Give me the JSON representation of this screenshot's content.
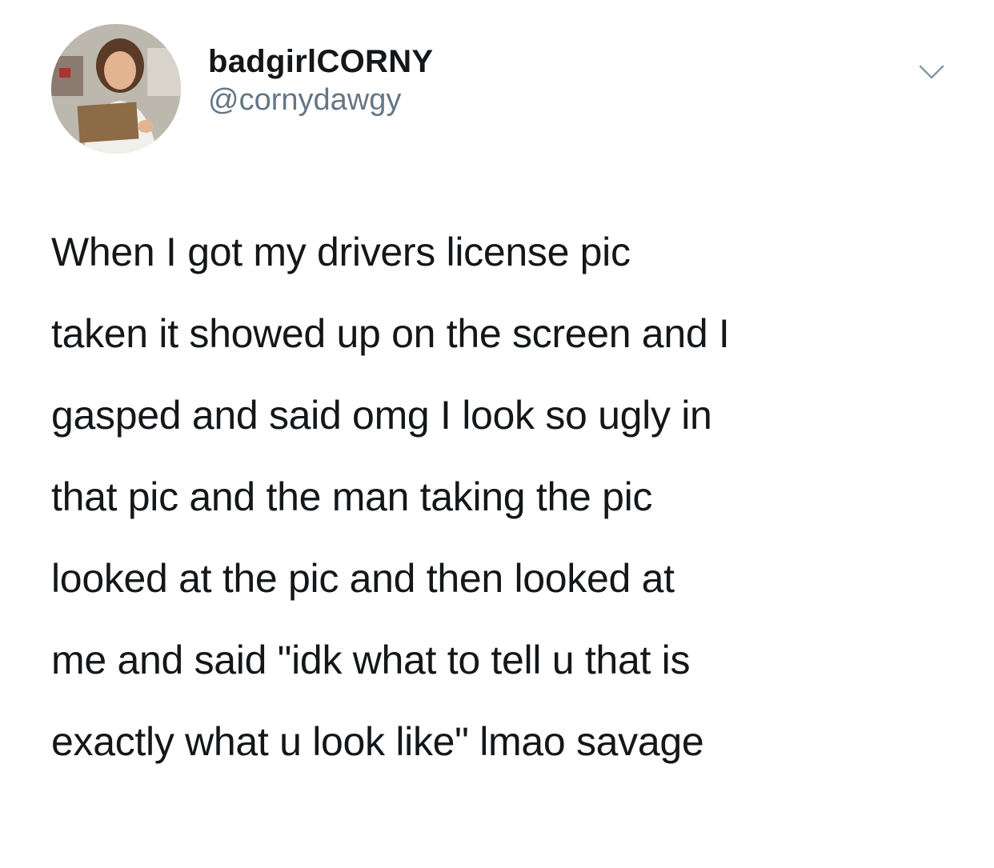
{
  "tweet": {
    "author": {
      "display_name": "badgirlCORNY",
      "handle": "@cornydawgy",
      "avatar_icon": "profile-photo"
    },
    "menu_icon": "chevron-down-icon",
    "text_lines": [
      "When I got my drivers license pic",
      "taken it showed up on the screen and I",
      "gasped and said omg I look so ugly in",
      "that pic and the man taking the pic",
      "looked at the pic and then looked at",
      "me and said \"idk what to tell u that is",
      "exactly what u look like\" lmao savage"
    ]
  },
  "colors": {
    "text": "#14171a",
    "handle": "#657786",
    "chevron": "#8899a6",
    "background": "#ffffff"
  }
}
